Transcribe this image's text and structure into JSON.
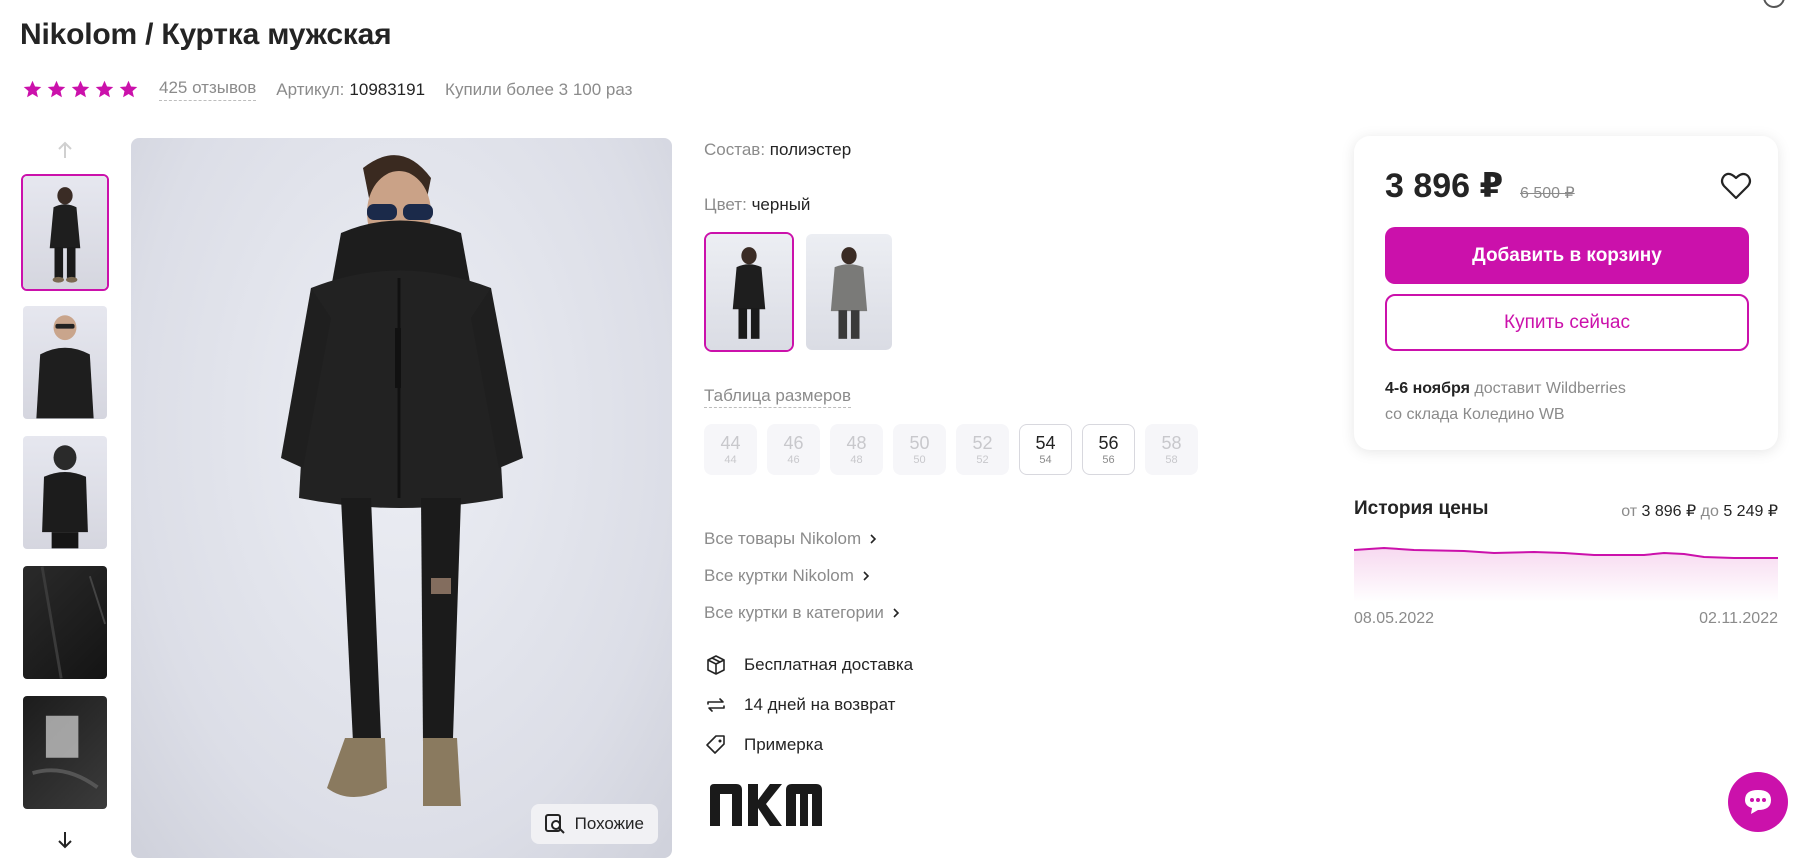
{
  "product": {
    "brand": "Nikolom",
    "title": "Nikolom / Куртка мужская",
    "rating": 5,
    "reviews": "425 отзывов",
    "article_label": "Артикул:",
    "article_value": "10983191",
    "bought": "Купили более 3 100 раз"
  },
  "gallery": {
    "thumbnail_count": 5,
    "active_index": 0,
    "similar_label": "Похожие"
  },
  "details": {
    "composition_label": "Состав:",
    "composition_value": "полиэстер",
    "color_label": "Цвет:",
    "color_value": "черный",
    "colors": [
      "черный",
      "серый"
    ],
    "size_table_label": "Таблица размеров",
    "sizes": [
      {
        "ru": "44",
        "intl": "44",
        "available": false
      },
      {
        "ru": "46",
        "intl": "46",
        "available": false
      },
      {
        "ru": "48",
        "intl": "48",
        "available": false
      },
      {
        "ru": "50",
        "intl": "50",
        "available": false
      },
      {
        "ru": "52",
        "intl": "52",
        "available": false
      },
      {
        "ru": "54",
        "intl": "54",
        "available": true
      },
      {
        "ru": "56",
        "intl": "56",
        "available": true
      },
      {
        "ru": "58",
        "intl": "58",
        "available": false
      }
    ],
    "links": [
      "Все товары Nikolom",
      "Все куртки Nikolom",
      "Все куртки в категории"
    ],
    "features": [
      {
        "icon": "box-icon",
        "label": "Бесплатная доставка"
      },
      {
        "icon": "return-arrows-icon",
        "label": "14 дней на возврат"
      },
      {
        "icon": "tag-icon",
        "label": "Примерка"
      }
    ],
    "brand_logo_text": "NKM"
  },
  "buy": {
    "price": "3 896 ₽",
    "old_price": "6 500 ₽",
    "add_to_cart": "Добавить в корзину",
    "buy_now": "Купить сейчас",
    "delivery_date": "4-6 ноября",
    "delivery_text": "доставит Wildberries",
    "delivery_warehouse": "со склада Коледино WB"
  },
  "price_history": {
    "title": "История цены",
    "from_label": "от",
    "from_value": "3 896 ₽",
    "to_label": "до",
    "to_value": "5 249 ₽",
    "start_date": "08.05.2022",
    "end_date": "02.11.2022"
  },
  "colors": {
    "accent": "#cb11ab",
    "text": "#242424",
    "muted": "#8b8b8b"
  }
}
